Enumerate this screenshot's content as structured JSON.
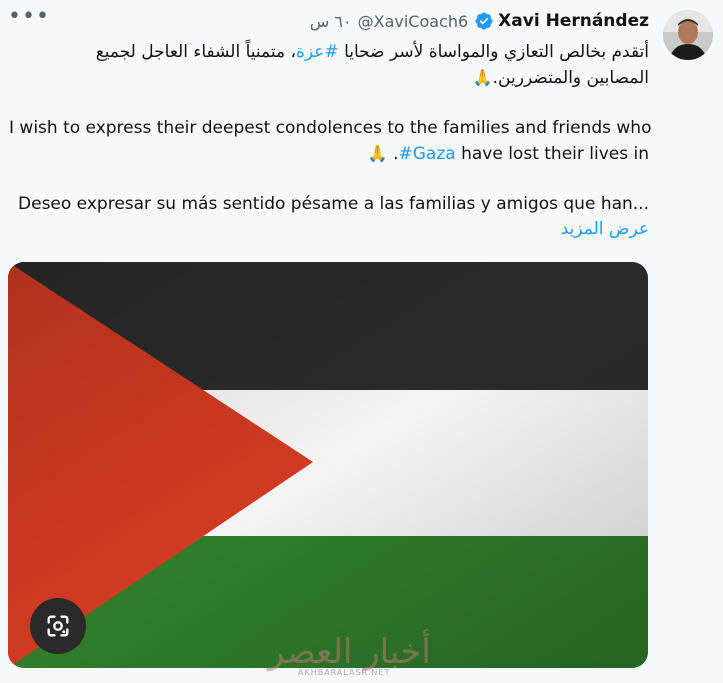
{
  "tweet": {
    "author_name": "Xavi Hernández",
    "handle": "@XaviCoach6",
    "time": "٦٠ س",
    "more_glyph": "•••",
    "arabic_line1": "أتقدم بخالص التعازي والمواساة لأسر ضحايا",
    "arabic_hashtag": "#عزة",
    "arabic_line1_tail": "، متمنياً الشفاء العاجل لجميع",
    "arabic_line2": "المصابين والمتضررين.",
    "english_line1": "I wish to express their deepest condolences to the families and friends who",
    "english_line2_pre": "have lost their lives in",
    "english_hashtag": "#Gaza",
    "english_line2_post": ".",
    "spanish_line1": "Deseo expresar su más sentido pésame a las familias y amigos que han...",
    "show_more": "عرض المزيد",
    "pray_emoji": "🙏",
    "media_alt": "Palestinian flag"
  },
  "watermark": {
    "text": "أخبار العصر",
    "sub": "AKHBARALASR.NET"
  },
  "colors": {
    "link": "#1d9bf0",
    "verified": "#1d9bf0",
    "flag_black": "#2b2b2b",
    "flag_white": "#f4f4f4",
    "flag_green": "#2f7d2a",
    "flag_red": "#d13a22"
  },
  "icons": {
    "verified": "verified-badge-icon",
    "more": "more-options-icon",
    "lens": "google-lens-icon"
  }
}
